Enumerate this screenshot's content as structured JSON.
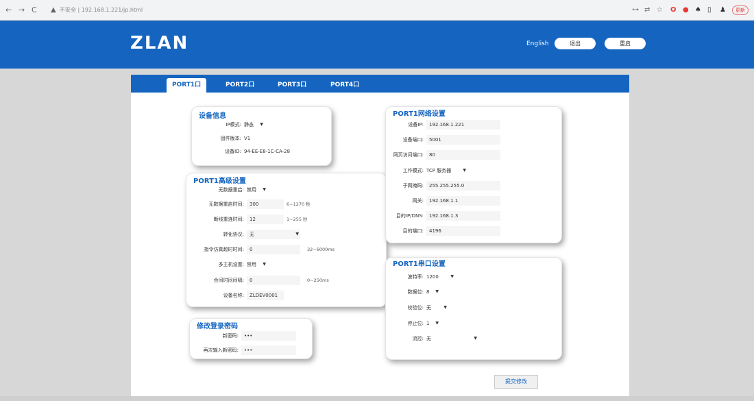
{
  "browser": {
    "back": "←",
    "forward": "→",
    "reload": "C",
    "warning_icon": "▲",
    "url": "不安全 | 192.168.1.221/jp.html",
    "ext_icons": [
      "⊶",
      "⇄",
      "☆",
      "O",
      "●",
      "♠",
      "▯",
      "♟"
    ],
    "update_label": "更新"
  },
  "header": {
    "logo": "ZLAN",
    "lang": "English",
    "btn_logout": "退出",
    "btn_restart": "重启"
  },
  "tabs": [
    "PORT1口",
    "PORT2口",
    "PORT3口",
    "PORT4口"
  ],
  "device_info": {
    "title": "设备信息",
    "ip_mode_label": "IP模式:",
    "ip_mode_value": "静态",
    "firmware_label": "固件版本:",
    "firmware_value": "V1",
    "device_id_label": "设备ID:",
    "device_id_value": "94-EE-E8-1C-CA-28"
  },
  "advanced": {
    "title": "PORT1高级设置",
    "no_data_restart_label": "无数据重启:",
    "no_data_restart_value": "禁用",
    "no_data_restart_time_label": "无数据重启时间:",
    "no_data_restart_time_value": "300",
    "no_data_restart_time_hint": "6~1270 秒",
    "reconnect_time_label": "断线重连时间:",
    "reconnect_time_value": "12",
    "reconnect_time_hint": "1~255 秒",
    "conversion_label": "转化协议:",
    "conversion_value": "无",
    "instr_timeout_label": "指令仿真超时时间:",
    "instr_timeout_value": "0",
    "instr_timeout_hint": "32~6000ms",
    "multi_host_label": "多主机设置:",
    "multi_host_value": "禁用",
    "poll_interval_label": "合间时间间隔:",
    "poll_interval_value": "0",
    "poll_interval_hint": "0~250ms",
    "device_name_label": "设备名称:",
    "device_name_value": "ZLDEV0001"
  },
  "password": {
    "title": "修改登录密码",
    "new_label": "新密码:",
    "new_value": "•••",
    "confirm_label": "再次输入新密码:",
    "confirm_value": "•••"
  },
  "network": {
    "title": "PORT1网络设置",
    "ip_label": "设备IP:",
    "ip_value": "192.168.1.221",
    "port_label": "设备端口:",
    "port_value": "5001",
    "web_port_label": "网页访问端口:",
    "web_port_value": "80",
    "mode_label": "工作模式:",
    "mode_value": "TCP 服务器",
    "mask_label": "子网掩码:",
    "mask_value": "255.255.255.0",
    "gateway_label": "网关:",
    "gateway_value": "192.168.1.1",
    "dest_ip_label": "目的IP/DNS:",
    "dest_ip_value": "192.168.1.3",
    "dest_port_label": "目的端口:",
    "dest_port_value": "4196"
  },
  "serial": {
    "title": "PORT1串口设置",
    "baud_label": "波特率:",
    "baud_value": "1200",
    "data_bits_label": "数据位:",
    "data_bits_value": "8",
    "parity_label": "校验位:",
    "parity_value": "无",
    "stop_bits_label": "停止位:",
    "stop_bits_value": "1",
    "flow_label": "流控:",
    "flow_value": "无"
  },
  "submit_label": "提交修改",
  "colors": {
    "brand_blue": "#1565c0",
    "page_bg": "#d7d7d7"
  }
}
